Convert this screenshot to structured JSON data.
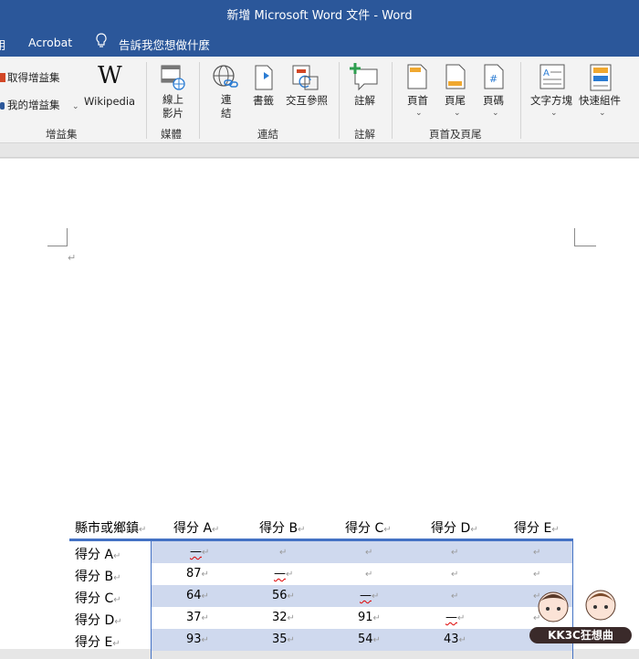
{
  "window": {
    "title": "新增 Microsoft Word 文件 - Word"
  },
  "menubar": {
    "tab_partial": "用",
    "tab_acrobat": "Acrobat",
    "tell_me": "告訴我您想做什麼"
  },
  "ribbon": {
    "addins": {
      "get_addins": "取得增益集",
      "my_addins": "我的增益集",
      "wikipedia": "Wikipedia",
      "group": "增益集"
    },
    "media": {
      "online_video_l1": "線上",
      "online_video_l2": "影片",
      "group": "媒體"
    },
    "links": {
      "link_l1": "連",
      "link_l2": "結",
      "bookmark": "書籤",
      "cross_ref": "交互參照",
      "group": "連結"
    },
    "comments": {
      "comment": "註解",
      "group": "註解"
    },
    "header_footer": {
      "header": "頁首",
      "footer": "頁尾",
      "page_number": "頁碼",
      "group": "頁首及頁尾"
    },
    "text": {
      "text_box": "文字方塊",
      "quick_parts": "快速組件"
    }
  },
  "document": {
    "paragraph_mark": "↵",
    "table": {
      "corner": "縣市或鄉鎮",
      "columns": [
        "得分 A",
        "得分 B",
        "得分 C",
        "得分 D",
        "得分 E"
      ],
      "rows": [
        {
          "label": "得分 A",
          "cells": [
            "—",
            "",
            "",
            "",
            ""
          ]
        },
        {
          "label": "得分 B",
          "cells": [
            "87",
            "—",
            "",
            "",
            ""
          ]
        },
        {
          "label": "得分 C",
          "cells": [
            "64",
            "56",
            "—",
            "",
            ""
          ]
        },
        {
          "label": "得分 D",
          "cells": [
            "37",
            "32",
            "91",
            "—",
            ""
          ]
        },
        {
          "label": "得分 E",
          "cells": [
            "93",
            "35",
            "54",
            "43",
            ""
          ]
        }
      ]
    }
  },
  "watermark": {
    "text": "KK3C狂想曲"
  },
  "colors": {
    "title_bar": "#2b579a",
    "ribbon": "#f3f3f3",
    "table_shade": "#cfd9ee",
    "table_border": "#4472c4"
  }
}
